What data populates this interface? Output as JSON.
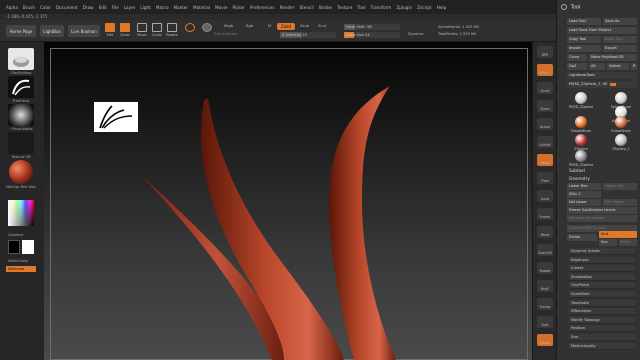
{
  "menu": [
    "Alpha",
    "Brush",
    "Color",
    "Document",
    "Draw",
    "Edit",
    "File",
    "Layer",
    "Light",
    "Macro",
    "Marker",
    "Material",
    "Movie",
    "Picker",
    "Preferences",
    "Render",
    "Stencil",
    "Stroke",
    "Texture",
    "Tool",
    "Transform",
    "Zplugin",
    "Zscript",
    "Help"
  ],
  "coords": "-1.486,-0.445,-1.375",
  "shelf": {
    "home_page": "Home Page",
    "lightbox": "LightBox",
    "live_boolean": "Live Boolean",
    "tools": [
      "Edit",
      "Draw",
      "Move",
      "Scale",
      "Rotate"
    ],
    "mrgb": "Mrgb",
    "rgb": "Rgb",
    "m": "M",
    "zadd": "Zadd",
    "zsub": "Zsub",
    "zcut": "Zcut",
    "rgb_intensity": "Rgb Intensity",
    "z_intensity": "Z Intensity 25",
    "focal_shift": "Focal Shift -56",
    "draw_size": "Draw Size 24",
    "dynamic": "Dynamic",
    "active_points": "ActivePoints: 1.525 Mil",
    "total_points": "TotalPoints: 1.525 Mil"
  },
  "left": {
    "brush": "ClayBuildup",
    "stroke": "FreeHand",
    "alpha": "~BrushAlpha",
    "texture": "Texture Off",
    "material": "MatCap Red Wax",
    "gradient": "Gradient",
    "switch_color": "SwitchColor",
    "alternate": "Alternate"
  },
  "right_toolbar": [
    "BPR",
    "SPix 3",
    "Scroll",
    "Zoom",
    "Actual",
    "AAHalf",
    "Persp",
    "Floor",
    "Local",
    "Frame",
    "Move",
    "Zoom3D",
    "Rotate",
    "PolyF",
    "Transp",
    "Solo",
    "Xpose"
  ],
  "panel": {
    "title": "Tool",
    "load_tool": "Load Tool",
    "save_as": "Save As",
    "load_from_project": "Load Tools From Project",
    "copy_tool": "Copy Tool",
    "paste_tool": "Paste Tool",
    "import": "Import",
    "export": "Export",
    "clone": "Clone",
    "make_polymesh": "Make PolyMesh3D",
    "goz": "GoZ",
    "all": "All",
    "visible": "Visible",
    "r": "R",
    "lightbox_tools": "Lightbox▸Tools",
    "current_tool": "PM3D_ZSphere_1. 49",
    "tools": [
      {
        "label": "PM3D_ZSphere",
        "color": "#c8c8c8"
      },
      {
        "label": "SphereBrush",
        "color": "#d0d0d0"
      },
      {
        "label": "AlphaBrush",
        "color": "#e0e0e0"
      },
      {
        "label": "SimpleBrush",
        "color": "#e26a1c"
      },
      {
        "label": "EraserBrush",
        "color": "#cc6a3a"
      },
      {
        "label": "ZSphere",
        "color": "#c03030"
      },
      {
        "label": "ZSphere_1",
        "color": "#bbbbbb"
      },
      {
        "label": "PM3D_ZSphere",
        "color": "#888888"
      }
    ],
    "subtool": "Subtool",
    "geometry": "Geometry",
    "lower_res": "Lower Res",
    "higher_res": "Higher Res",
    "sdiv": "SDiv 2",
    "del_lower": "Del Lower",
    "del_higher": "Del Higher",
    "freeze_subdiv": "Freeze SubDivision Levels",
    "reconstruct_subdiv": "Reconstruct Subdiv",
    "convert_bpr": "Convert BPR To Geo",
    "divide": "Divide",
    "smt": "Smt",
    "suv": "Suv",
    "reuv": "ReUV",
    "items": [
      "Dynamic Subdiv",
      "EdgeLoop",
      "Crease",
      "ShadowBox",
      "ClayPolish",
      "DynaMesh",
      "Tessimate",
      "ZRemesher",
      "Modify Topology",
      "Position",
      "Size",
      "MeshIntegrity"
    ]
  }
}
